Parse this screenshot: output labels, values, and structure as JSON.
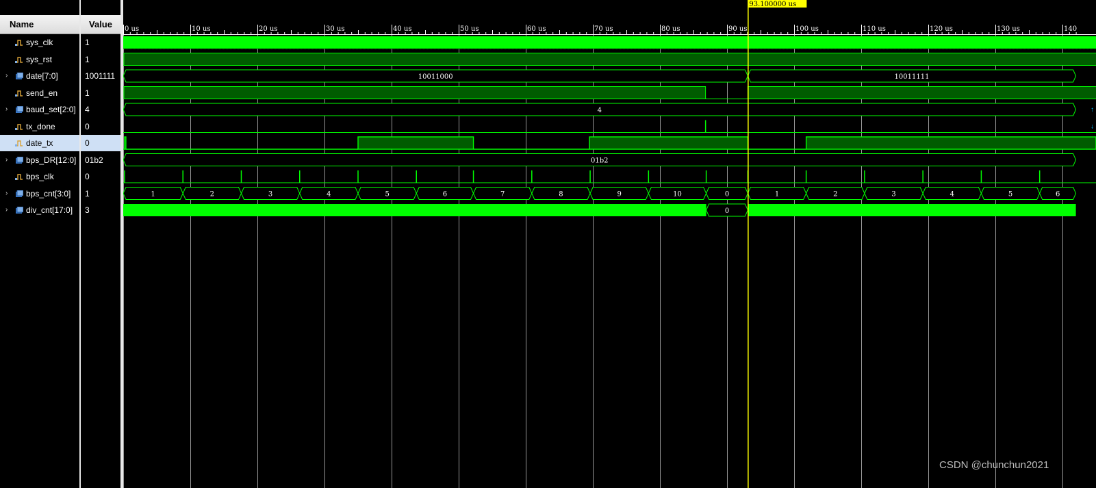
{
  "headers": {
    "name": "Name",
    "value": "Value"
  },
  "signals": [
    {
      "name": "sys_clk",
      "value": "1",
      "bus": false,
      "selected": false
    },
    {
      "name": "sys_rst",
      "value": "1",
      "bus": false,
      "selected": false
    },
    {
      "name": "date[7:0]",
      "value": "1001111",
      "bus": true,
      "selected": false
    },
    {
      "name": "send_en",
      "value": "1",
      "bus": false,
      "selected": false
    },
    {
      "name": "baud_set[2:0]",
      "value": "4",
      "bus": true,
      "selected": false
    },
    {
      "name": "tx_done",
      "value": "0",
      "bus": false,
      "selected": false
    },
    {
      "name": "date_tx",
      "value": "0",
      "bus": false,
      "selected": true
    },
    {
      "name": "bps_DR[12:0]",
      "value": "01b2",
      "bus": true,
      "selected": false
    },
    {
      "name": "bps_clk",
      "value": "0",
      "bus": false,
      "selected": false
    },
    {
      "name": "bps_cnt[3:0]",
      "value": "1",
      "bus": true,
      "selected": false
    },
    {
      "name": "div_cnt[17:0]",
      "value": "3",
      "bus": true,
      "selected": false
    }
  ],
  "timeline": {
    "unit": "us",
    "start": 0,
    "end": 142,
    "major_ticks": [
      {
        "t": 0,
        "label": "0 us"
      },
      {
        "t": 10,
        "label": "10 us"
      },
      {
        "t": 20,
        "label": "20 us"
      },
      {
        "t": 30,
        "label": "30 us"
      },
      {
        "t": 40,
        "label": "40 us"
      },
      {
        "t": 50,
        "label": "50 us"
      },
      {
        "t": 60,
        "label": "60 us"
      },
      {
        "t": 70,
        "label": "70 us"
      },
      {
        "t": 80,
        "label": "80 us"
      },
      {
        "t": 90,
        "label": "90 us"
      },
      {
        "t": 100,
        "label": "100 us"
      },
      {
        "t": 110,
        "label": "110 us"
      },
      {
        "t": 120,
        "label": "120 us"
      },
      {
        "t": 130,
        "label": "130 us"
      },
      {
        "t": 140,
        "label": "140"
      }
    ],
    "cursor": {
      "t": 93.1,
      "label": "93.100000 us"
    }
  },
  "waves": {
    "date": [
      {
        "from": 0,
        "to": 93.1,
        "label": "10011000"
      },
      {
        "from": 93.1,
        "to": 142,
        "label": "10011111"
      }
    ],
    "send_en_fall": 86.8,
    "baud_set": [
      {
        "from": 0,
        "to": 142,
        "label": "4"
      }
    ],
    "tx_done_pulse": 86.8,
    "date_tx_edges": [
      {
        "t": 0,
        "level": 0
      },
      {
        "t": 0.2,
        "level": 1
      },
      {
        "t": 0.4,
        "level": 0
      },
      {
        "t": 35,
        "level": 1
      },
      {
        "t": 52.2,
        "level": 0
      },
      {
        "t": 69.5,
        "level": 1
      },
      {
        "t": 93.1,
        "level": 0
      },
      {
        "t": 101.8,
        "level": 1
      }
    ],
    "bps_DR": [
      {
        "from": 0,
        "to": 142,
        "label": "01b2"
      }
    ],
    "bps_clk_pulses": [
      0.2,
      8.9,
      17.6,
      26.3,
      35,
      43.7,
      52.2,
      60.9,
      69.6,
      78.3,
      86.9,
      93.1,
      101.8,
      110.5,
      119.2,
      127.9,
      136.6
    ],
    "bps_cnt": [
      {
        "from": 0,
        "to": 8.9,
        "label": "1"
      },
      {
        "from": 8.9,
        "to": 17.6,
        "label": "2"
      },
      {
        "from": 17.6,
        "to": 26.3,
        "label": "3"
      },
      {
        "from": 26.3,
        "to": 35,
        "label": "4"
      },
      {
        "from": 35,
        "to": 43.7,
        "label": "5"
      },
      {
        "from": 43.7,
        "to": 52.2,
        "label": "6"
      },
      {
        "from": 52.2,
        "to": 60.9,
        "label": "7"
      },
      {
        "from": 60.9,
        "to": 69.6,
        "label": "8"
      },
      {
        "from": 69.6,
        "to": 78.3,
        "label": "9"
      },
      {
        "from": 78.3,
        "to": 86.9,
        "label": "10"
      },
      {
        "from": 86.9,
        "to": 93.1,
        "label": "0"
      },
      {
        "from": 93.1,
        "to": 101.8,
        "label": "1"
      },
      {
        "from": 101.8,
        "to": 110.5,
        "label": "2"
      },
      {
        "from": 110.5,
        "to": 119.2,
        "label": "3"
      },
      {
        "from": 119.2,
        "to": 127.9,
        "label": "4"
      },
      {
        "from": 127.9,
        "to": 136.6,
        "label": "5"
      },
      {
        "from": 136.6,
        "to": 142,
        "label": "6"
      }
    ],
    "div_cnt": [
      {
        "from": 0,
        "to": 86.9,
        "dense": true
      },
      {
        "from": 86.9,
        "to": 93.1,
        "dense": false,
        "label": "0"
      },
      {
        "from": 93.1,
        "to": 142,
        "dense": true
      }
    ]
  },
  "colors": {
    "wave": "#00ff00",
    "wave_fill": "#005c00",
    "cursor": "#ffff00",
    "grid": "#ffffff",
    "selected_row": "#cfe0f5"
  },
  "watermark": "CSDN @chunchun2021"
}
